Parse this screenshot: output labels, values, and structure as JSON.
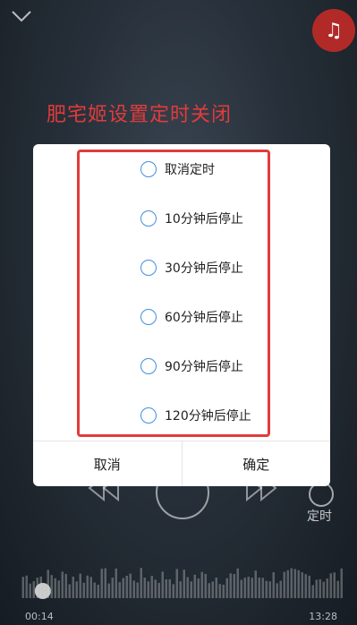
{
  "overlay_title": "肥宅姬设置定时关闭",
  "brand_icon": "music-app-logo-icon",
  "colors": {
    "accent": "#e23b3b",
    "radio": "#3f8fe0",
    "brand": "#b22a27"
  },
  "dialog": {
    "options": [
      {
        "label": "取消定时"
      },
      {
        "label": "10分钟后停止"
      },
      {
        "label": "30分钟后停止"
      },
      {
        "label": "60分钟后停止"
      },
      {
        "label": "90分钟后停止"
      },
      {
        "label": "120分钟后停止"
      }
    ],
    "cancel_label": "取消",
    "confirm_label": "确定"
  },
  "player": {
    "timer_label": "定时",
    "elapsed": "00:14",
    "total": "13:28",
    "progress": 0.018
  }
}
